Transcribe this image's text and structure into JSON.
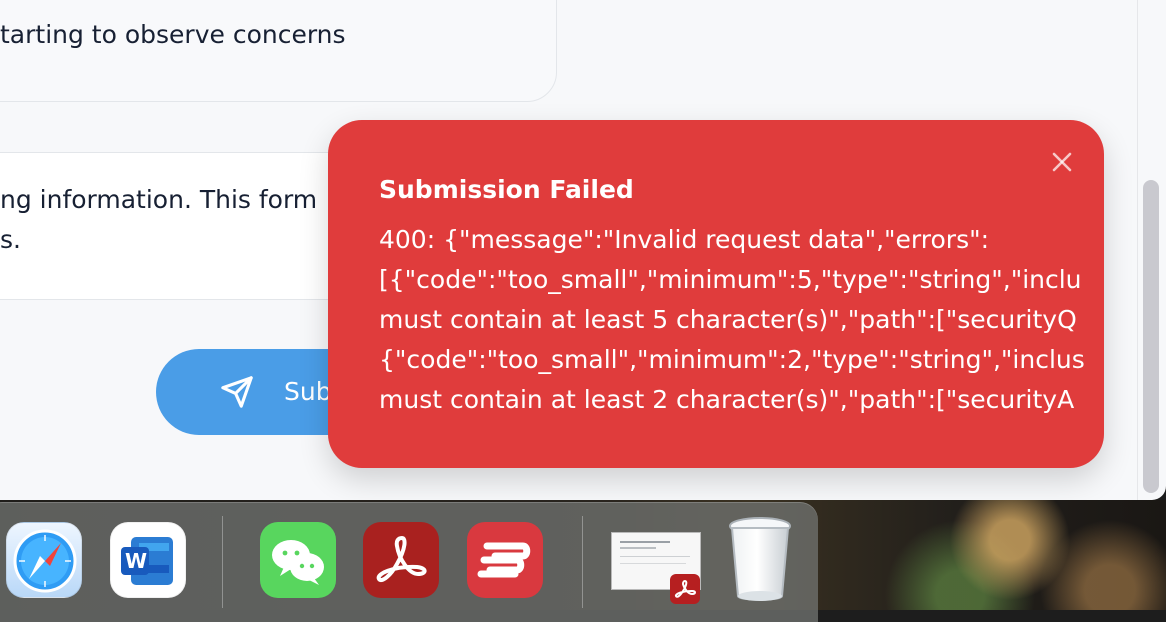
{
  "window": {
    "top_card_text": "tarting to observe concerns",
    "info_line_1": "ng information. This form",
    "info_line_2": "s.",
    "submit_label": "Sub"
  },
  "toast": {
    "title": "Submission Failed",
    "lines": [
      "400: {\"message\":\"Invalid request data\",\"errors\":",
      "[{\"code\":\"too_small\",\"minimum\":5,\"type\":\"string\",\"inclu",
      "must contain at least 5 character(s)\",\"path\":[\"securityQ",
      "{\"code\":\"too_small\",\"minimum\":2,\"type\":\"string\",\"inclus",
      "must contain at least 2 character(s)\",\"path\":[\"securityA"
    ]
  },
  "dock": {
    "icons": [
      "safari-icon",
      "microsoft-word-icon",
      "wechat-icon",
      "adobe-acrobat-icon",
      "expressvpn-icon",
      "document-preview-icon",
      "trash-icon"
    ]
  },
  "colors": {
    "toast_background": "#e03c3c",
    "button_background": "#4a9de7",
    "text_primary": "#172033",
    "window_background": "#f7f8fa"
  }
}
